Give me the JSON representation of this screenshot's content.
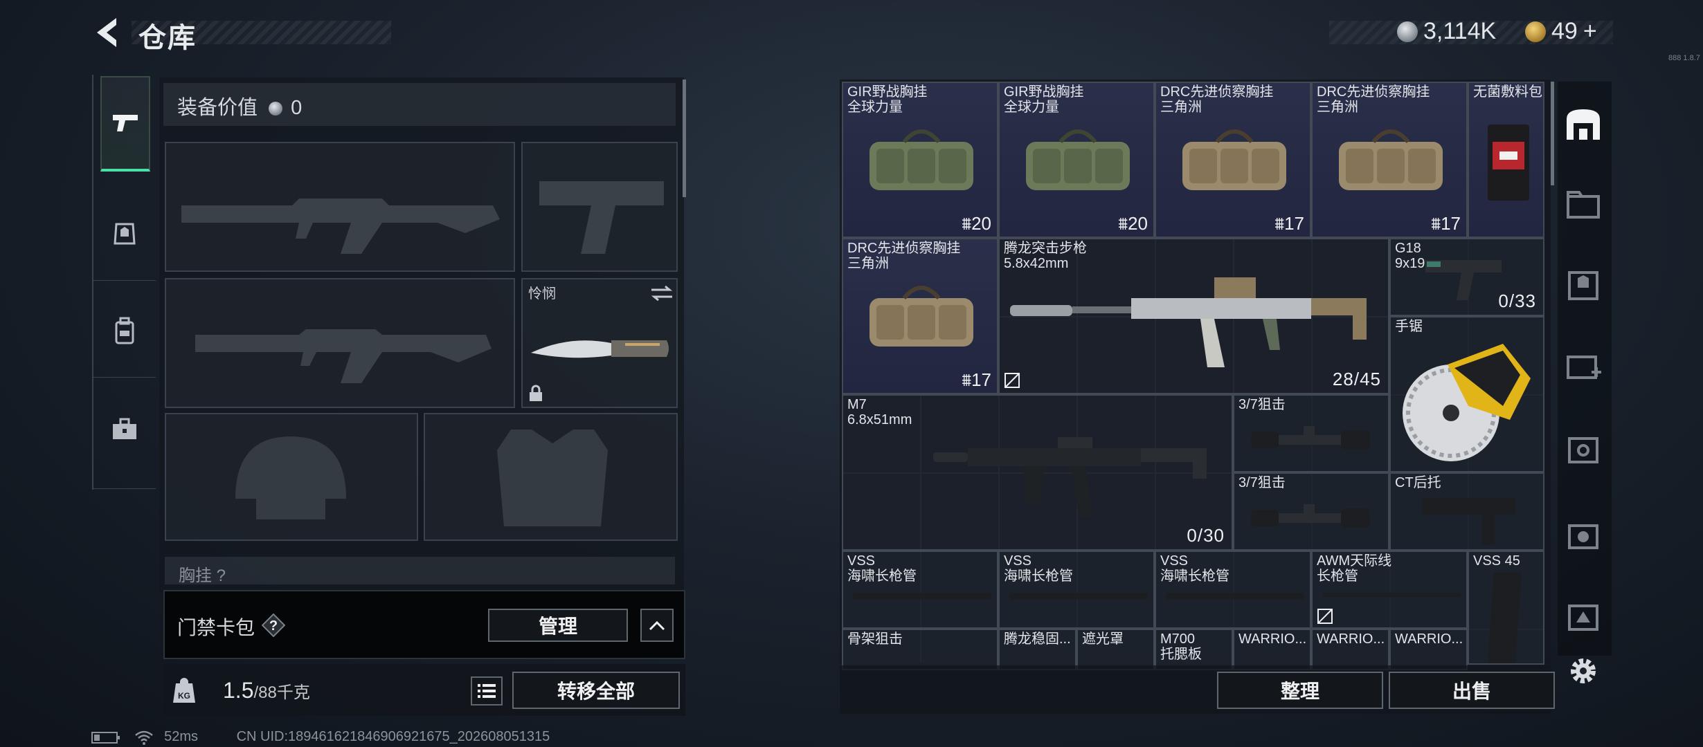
{
  "header": {
    "title": "仓库"
  },
  "currency": {
    "silver": "3,114K",
    "gold": "49",
    "gold_plus": "+"
  },
  "version": "888 1.8.7",
  "loadout": {
    "title": "装备价值",
    "value": "0",
    "melee_label": "怜悯",
    "partial_label": "胸挂 ?"
  },
  "keycard": {
    "label": "门禁卡包",
    "help": "?",
    "manage": "管理"
  },
  "weight": {
    "current": "1.5",
    "max": "/88千克"
  },
  "transfer_all": "转移全部",
  "stash": {
    "items": [
      {
        "name": "GIR野战胸挂",
        "sub": "全球力量",
        "count": "20"
      },
      {
        "name": "GIR野战胸挂",
        "sub": "全球力量",
        "count": "20"
      },
      {
        "name": "DRC先进侦察胸挂",
        "sub": "三角洲",
        "count": "17"
      },
      {
        "name": "DRC先进侦察胸挂",
        "sub": "三角洲",
        "count": "17"
      },
      {
        "name": "无菌敷料包"
      },
      {
        "name": "DRC先进侦察胸挂",
        "sub": "三角洲",
        "count": "17"
      },
      {
        "name": "腾龙突击步枪",
        "sub": "5.8x42mm",
        "ammo": "28/45"
      },
      {
        "name": "G18",
        "sub": "9x19mm",
        "ammo": "0/33"
      },
      {
        "name": "手锯"
      },
      {
        "name": "M7",
        "sub": "6.8x51mm",
        "ammo": "0/30"
      },
      {
        "name": "3/7狙击"
      },
      {
        "name": "3/7狙击"
      },
      {
        "name": "CT后托"
      },
      {
        "name": "VSS",
        "sub": "海啸长枪管"
      },
      {
        "name": "VSS",
        "sub": "海啸长枪管"
      },
      {
        "name": "VSS",
        "sub": "海啸长枪管"
      },
      {
        "name": "AWM天际线",
        "sub": "长枪管"
      },
      {
        "name": "VSS 45"
      },
      {
        "name": "骨架狙击"
      },
      {
        "name": "腾龙稳固..."
      },
      {
        "name": "遮光罩"
      },
      {
        "name": "M700",
        "sub": "托腮板"
      },
      {
        "name": "WARRIO..."
      },
      {
        "name": "WARRIO..."
      },
      {
        "name": "WARRIO..."
      }
    ]
  },
  "actions": {
    "sort": "整理",
    "sell": "出售"
  },
  "status": {
    "ping": "52ms",
    "uid": "CN UID:18946162184690692​1675_202608051315"
  }
}
